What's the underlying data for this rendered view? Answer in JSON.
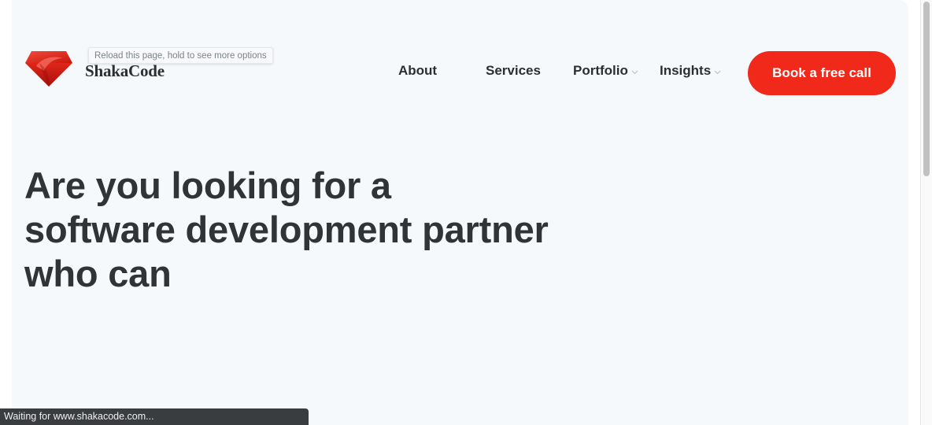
{
  "header": {
    "brand": "ShakaCode",
    "tooltip": "Reload this page, hold to see more options"
  },
  "nav": {
    "items": [
      {
        "label": "About",
        "has_dropdown": false
      },
      {
        "label": "Services",
        "has_dropdown": false
      },
      {
        "label": "Portfolio",
        "has_dropdown": true
      },
      {
        "label": "Insights",
        "has_dropdown": true
      }
    ],
    "cta_label": "Book a free call"
  },
  "hero": {
    "lines": [
      "Are you looking for a",
      "software development partner",
      "who can"
    ]
  },
  "status": {
    "text": "Waiting for www.shakacode.com..."
  },
  "colors": {
    "accent": "#f0291b",
    "page_background": "#f5f9fb",
    "text": "#2f3436"
  },
  "icons": {
    "logo": "ruby-gem-icon",
    "dropdown": "chevron-down-icon"
  }
}
